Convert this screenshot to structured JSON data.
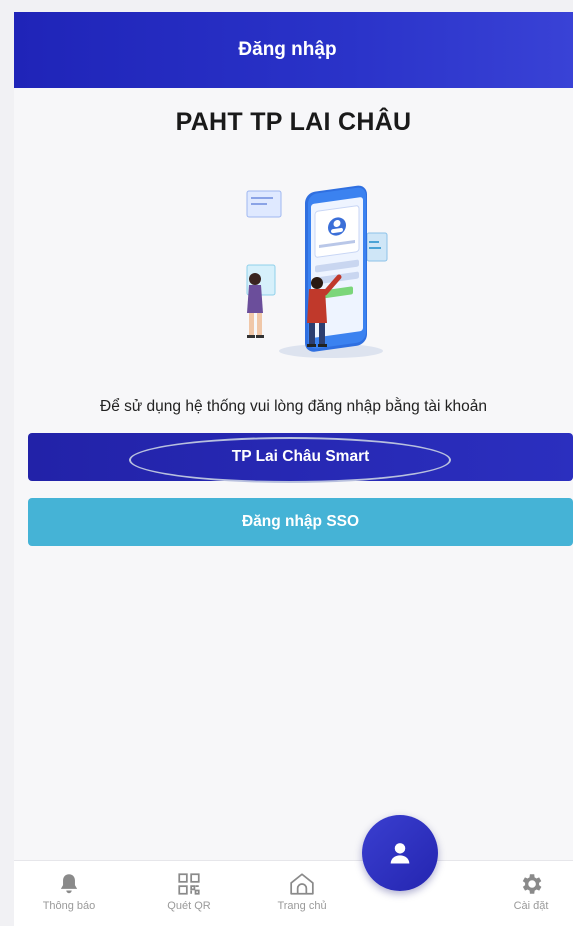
{
  "header": {
    "title": "Đăng nhập"
  },
  "app": {
    "name": "PAHT TP LAI CHÂU"
  },
  "login": {
    "instruction": "Để sử dụng hệ thống vui lòng đăng nhập bằng tài khoản",
    "smart_button": "TP  Lai Châu Smart",
    "sso_button": "Đăng nhập SSO"
  },
  "nav": {
    "items": [
      {
        "label": "Thông báo",
        "icon": "bell-icon"
      },
      {
        "label": "Quét QR",
        "icon": "qr-code-icon"
      },
      {
        "label": "Trang chủ",
        "icon": "home-icon"
      },
      {
        "label": "Cài đặt",
        "icon": "gear-icon"
      }
    ],
    "fab_icon": "user-icon"
  },
  "colors": {
    "primary": "#2a2fbf",
    "sso": "#45b3d6",
    "nav_text": "#9a9a9a"
  }
}
